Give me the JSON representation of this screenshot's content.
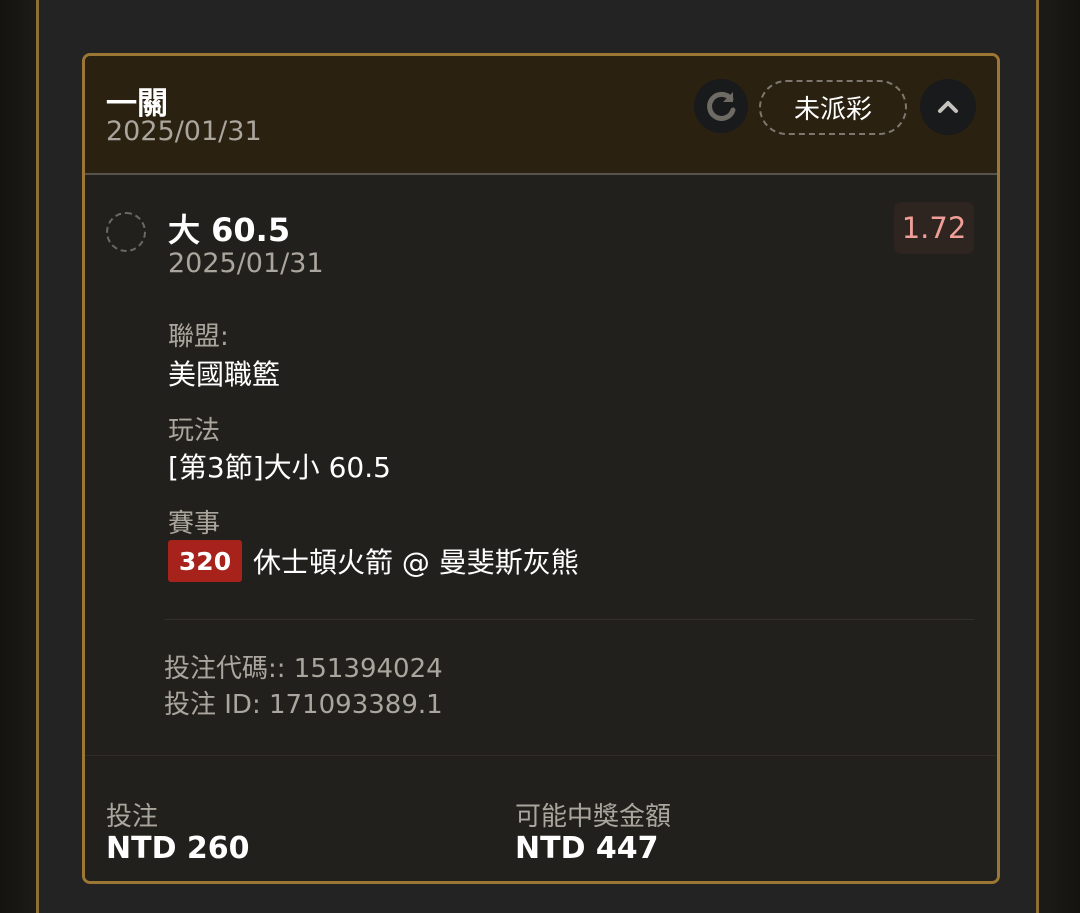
{
  "ticket": {
    "title": "一關",
    "date": "2025/01/31",
    "status_label": "未派彩",
    "refresh_icon": "refresh-icon",
    "collapse_icon": "chevron-up-icon"
  },
  "selection": {
    "name": "大 60.5",
    "date": "2025/01/31",
    "odds": "1.72",
    "league_label": "聯盟:",
    "league_value": "美國職籃",
    "market_label": "玩法",
    "market_value": "[第3節]大小 60.5",
    "event_label": "賽事",
    "event_number": "320",
    "event_name": "休士頓火箭 @ 曼斐斯灰熊"
  },
  "meta": {
    "bet_code": "投注代碼:: 151394024",
    "bet_id": "投注 ID: 171093389.1"
  },
  "footer": {
    "stake_label": "投注",
    "stake_value": "NTD 260",
    "payout_label": "可能中獎金額",
    "payout_value": "NTD 447"
  },
  "colors": {
    "accent": "#9b7634",
    "odds": "#ef9f98",
    "event_badge": "#a6221b"
  }
}
